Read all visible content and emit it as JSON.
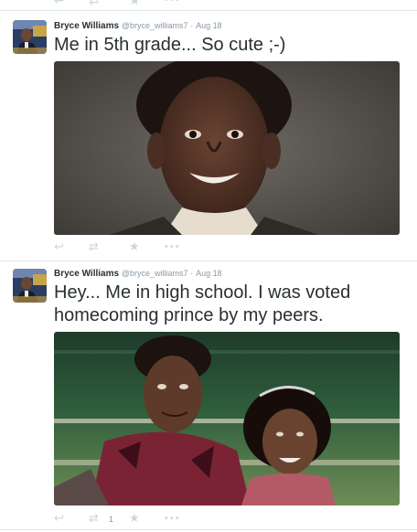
{
  "icons": {
    "reply": "reply-icon",
    "retweet": "retweet-icon",
    "favorite": "star-icon",
    "more": "more-icon"
  },
  "glyphs": {
    "reply": "↩",
    "retweet": "⇄",
    "favorite": "★",
    "more": "•••"
  },
  "tweets": [
    {
      "name": "Bryce Williams",
      "handle": "@bryce_williams7",
      "sep": "·",
      "time": "Aug 18",
      "text": "Me in 5th grade... So cute ;-)",
      "retweets": ""
    },
    {
      "name": "Bryce Williams",
      "handle": "@bryce_williams7",
      "sep": "·",
      "time": "Aug 18",
      "text": "Hey... Me in high school. I was voted homecoming prince by my peers.",
      "retweets": "1"
    }
  ],
  "colors": {
    "text": "#292f33",
    "muted": "#8899a6",
    "icon": "#ccd6dd",
    "divider": "#e1e8ed"
  }
}
